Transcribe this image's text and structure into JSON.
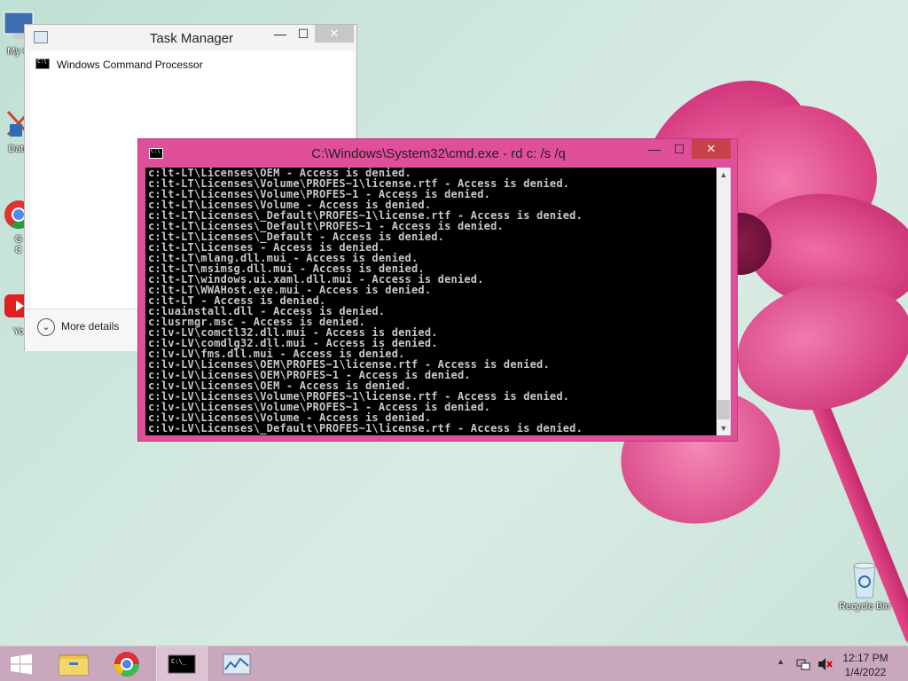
{
  "desktop": {
    "icons": [
      {
        "label": "My C",
        "icon": "computer-icon"
      },
      {
        "label": "Data",
        "icon": "recycle-icon"
      },
      {
        "label": "G\nC",
        "icon": "chrome-icon"
      },
      {
        "label": "Yo",
        "icon": "youtube-icon"
      },
      {
        "label": "Recycle Bin",
        "icon": "recycle-bin-icon"
      }
    ]
  },
  "task_manager": {
    "title": "Task Manager",
    "minimize": "—",
    "maximize": "☐",
    "close": "✕",
    "processes": [
      {
        "name": "Windows Command Processor",
        "icon": "cmd-icon"
      }
    ],
    "more_details": "More details"
  },
  "cmd": {
    "title": "C:\\Windows\\System32\\cmd.exe - rd  c: /s /q",
    "minimize": "—",
    "maximize": "☐",
    "close": "✕",
    "lines": [
      "c:lt-LT\\Licenses\\OEM - Access is denied.",
      "c:lt-LT\\Licenses\\Volume\\PROFES~1\\license.rtf - Access is denied.",
      "c:lt-LT\\Licenses\\Volume\\PROFES~1 - Access is denied.",
      "c:lt-LT\\Licenses\\Volume - Access is denied.",
      "c:lt-LT\\Licenses\\_Default\\PROFES~1\\license.rtf - Access is denied.",
      "c:lt-LT\\Licenses\\_Default\\PROFES~1 - Access is denied.",
      "c:lt-LT\\Licenses\\_Default - Access is denied.",
      "c:lt-LT\\Licenses - Access is denied.",
      "c:lt-LT\\mlang.dll.mui - Access is denied.",
      "c:lt-LT\\msimsg.dll.mui - Access is denied.",
      "c:lt-LT\\windows.ui.xaml.dll.mui - Access is denied.",
      "c:lt-LT\\WWAHost.exe.mui - Access is denied.",
      "c:lt-LT - Access is denied.",
      "c:luainstall.dll - Access is denied.",
      "c:lusrmgr.msc - Access is denied.",
      "c:lv-LV\\comctl32.dll.mui - Access is denied.",
      "c:lv-LV\\comdlg32.dll.mui - Access is denied.",
      "c:lv-LV\\fms.dll.mui - Access is denied.",
      "c:lv-LV\\Licenses\\OEM\\PROFES~1\\license.rtf - Access is denied.",
      "c:lv-LV\\Licenses\\OEM\\PROFES~1 - Access is denied.",
      "c:lv-LV\\Licenses\\OEM - Access is denied.",
      "c:lv-LV\\Licenses\\Volume\\PROFES~1\\license.rtf - Access is denied.",
      "c:lv-LV\\Licenses\\Volume\\PROFES~1 - Access is denied.",
      "c:lv-LV\\Licenses\\Volume - Access is denied.",
      "c:lv-LV\\Licenses\\_Default\\PROFES~1\\license.rtf - Access is denied."
    ]
  },
  "taskbar": {
    "items": [
      {
        "name": "start",
        "icon": "windows-logo-icon"
      },
      {
        "name": "file-explorer",
        "icon": "folder-icon"
      },
      {
        "name": "chrome",
        "icon": "chrome-icon"
      },
      {
        "name": "cmd",
        "icon": "cmd-icon",
        "active": true
      },
      {
        "name": "task-manager",
        "icon": "task-manager-icon"
      }
    ],
    "time": "12:17 PM",
    "date": "1/4/2022"
  },
  "colors": {
    "cmd_frame": "#e0509a",
    "close_red": "#c8404a",
    "taskbar": "#c9a7bd",
    "console_bg": "#000000",
    "console_text": "#c8c8c8"
  }
}
